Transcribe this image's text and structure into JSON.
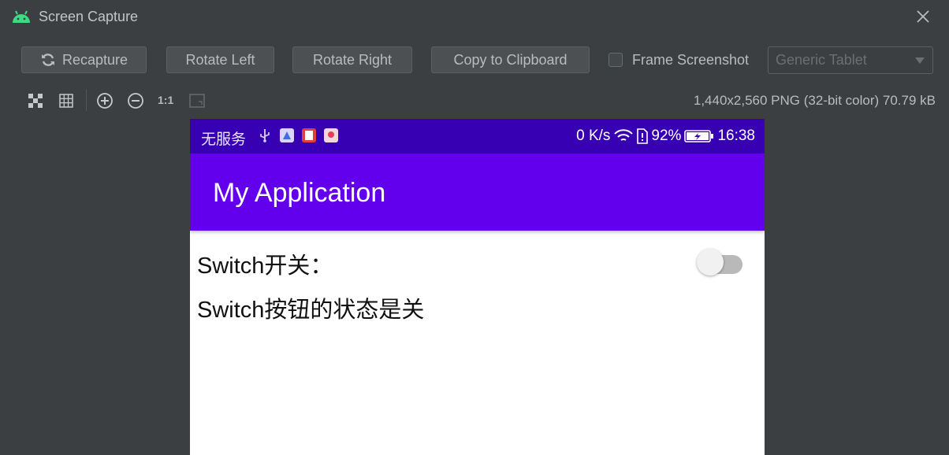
{
  "window": {
    "title": "Screen Capture"
  },
  "toolbar": {
    "recapture_label": "Recapture",
    "rotate_left_label": "Rotate Left",
    "rotate_right_label": "Rotate Right",
    "copy_label": "Copy to Clipboard",
    "frame_label": "Frame Screenshot",
    "frame_checked": false,
    "device_select": "Generic Tablet"
  },
  "viewer": {
    "one_to_one": "1:1",
    "image_info": "1,440x2,560 PNG (32-bit color) 70.79 kB"
  },
  "phone": {
    "status": {
      "carrier": "无服务",
      "speed": "0 K/s",
      "battery": "92%",
      "time": "16:38"
    },
    "app_title": "My Application",
    "switch_label": "Switch开关：",
    "switch_on": false,
    "state_text": "Switch按钮的状态是关"
  },
  "colors": {
    "status_bar": "#3700b3",
    "app_bar": "#6200ee",
    "ide_background": "#3c3f41"
  }
}
